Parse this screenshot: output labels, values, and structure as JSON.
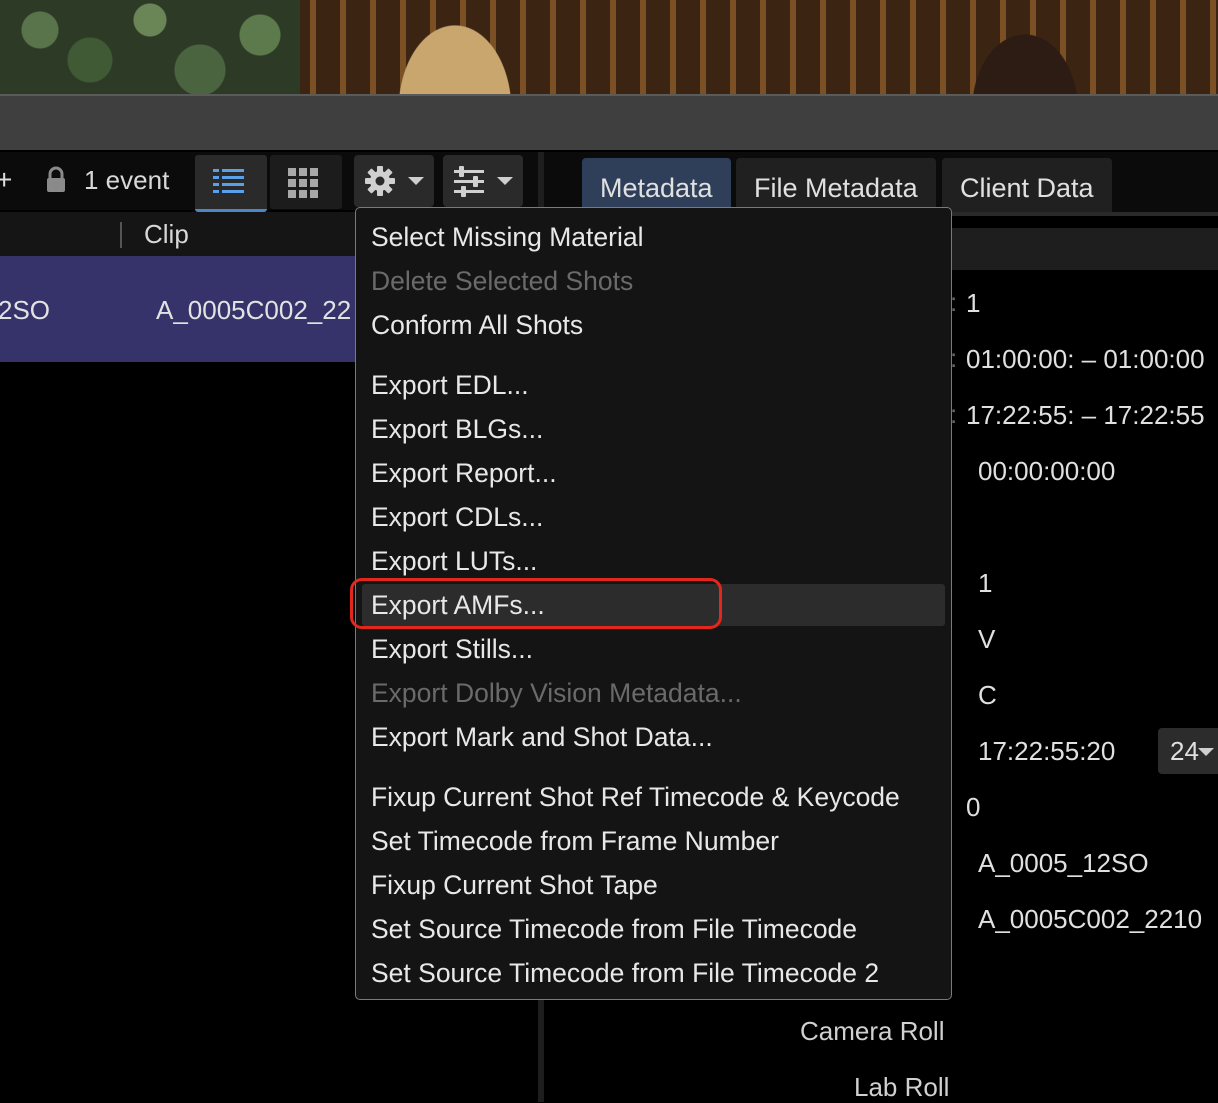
{
  "viewer": {
    "description_icon": "video-preview"
  },
  "shot_list": {
    "event_count": "1 event",
    "view_list_icon": "list-view-icon",
    "view_grid_icon": "grid-view-icon",
    "column_clip": "Clip",
    "rows": [
      {
        "name": "2SO",
        "clip": "A_0005C002_22"
      }
    ]
  },
  "right_panel": {
    "tabs": [
      "Metadata",
      "File Metadata",
      "Client Data"
    ],
    "active_tab": "Metadata",
    "values": {
      "v1": "1",
      "v2": "01:00:00: – 01:00:00",
      "v3": "17:22:55: – 17:22:55",
      "v4": "00:00:00:00",
      "v5": "1",
      "v6": "V",
      "v7": "C",
      "v8": "17:22:55:20",
      "v9": "0",
      "v10": "A_0005_12SO",
      "v11": "A_0005C002_2210"
    },
    "fps_select": "24",
    "labels": {
      "camera_roll": "Camera Roll",
      "lab_roll": "Lab Roll"
    }
  },
  "gear_menu": {
    "items": [
      {
        "label": "Select Missing Material",
        "enabled": true
      },
      {
        "label": "Delete Selected Shots",
        "enabled": false
      },
      {
        "label": "Conform All Shots",
        "enabled": true
      },
      {
        "label": "Export EDL...",
        "enabled": true
      },
      {
        "label": "Export BLGs...",
        "enabled": true
      },
      {
        "label": "Export Report...",
        "enabled": true
      },
      {
        "label": "Export CDLs...",
        "enabled": true
      },
      {
        "label": "Export LUTs...",
        "enabled": true
      },
      {
        "label": "Export AMFs...",
        "enabled": true,
        "hovered": true
      },
      {
        "label": "Export Stills...",
        "enabled": true
      },
      {
        "label": "Export Dolby Vision Metadata...",
        "enabled": false
      },
      {
        "label": "Export Mark and Shot Data...",
        "enabled": true
      },
      {
        "label": "Fixup Current Shot Ref Timecode & Keycode",
        "enabled": true
      },
      {
        "label": "Set Timecode from Frame Number",
        "enabled": true
      },
      {
        "label": "Fixup Current Shot Tape",
        "enabled": true
      },
      {
        "label": "Set Source Timecode from File Timecode",
        "enabled": true
      },
      {
        "label": "Set Source Timecode from File Timecode 2",
        "enabled": true
      }
    ]
  },
  "colors": {
    "accent_blue": "#4a86c8",
    "selection_row": "#35336a",
    "highlight_red": "#e3271c"
  }
}
